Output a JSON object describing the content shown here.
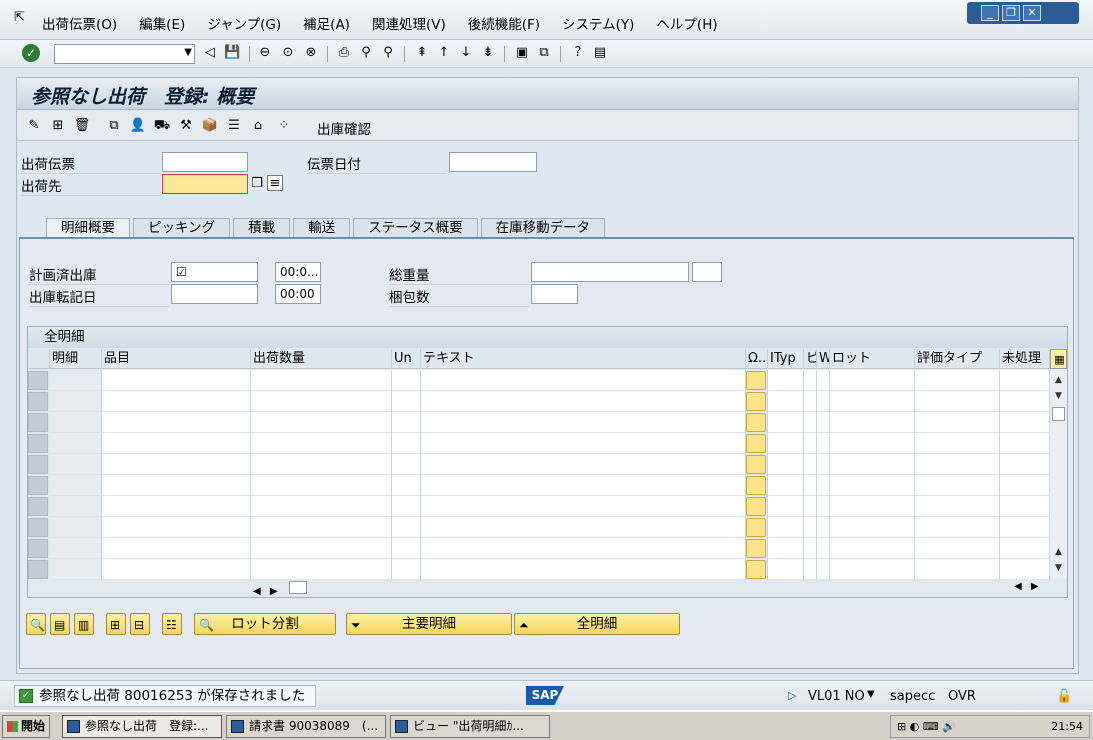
{
  "menubar": {
    "items": [
      "出荷伝票(O)",
      "編集(E)",
      "ジャンプ(G)",
      "補足(A)",
      "関連処理(V)",
      "後続機能(F)",
      "システム(Y)",
      "ヘルプ(H)"
    ]
  },
  "toolbar": {
    "command_value": ""
  },
  "title": "参照なし出荷　登録: 概要",
  "appbar": {
    "label": "出庫確認"
  },
  "header_fields": {
    "delivery_label": "出荷伝票",
    "delivery_value": "",
    "ship_to_label": "出荷先",
    "ship_to_value": "",
    "doc_date_label": "伝票日付",
    "doc_date_value": ""
  },
  "tabs": [
    "明細概要",
    "ピッキング",
    "積載",
    "輸送",
    "ステータス概要",
    "在庫移動データ"
  ],
  "tab_fields": {
    "planned_gi_label": "計画済出庫",
    "planned_gi_value": "☑",
    "planned_gi_time": "00:0...",
    "gi_posting_label": "出庫転記日",
    "gi_posting_value": "",
    "gi_posting_time": "00:00",
    "total_weight_label": "総重量",
    "total_weight_value": "",
    "total_weight_unit": "",
    "packages_label": "梱包数",
    "packages_value": ""
  },
  "table": {
    "title": "全明細",
    "columns": [
      "明細",
      "品目",
      "出荷数量",
      "Un",
      "テキスト",
      "Ω...",
      "ITyp",
      "ピ",
      "W",
      "ロット",
      "評価タイプ",
      "未処理"
    ],
    "rows": 10
  },
  "buttons": {
    "lot_split": "ロット分割",
    "main_items": "主要明細",
    "all_items": "全明細"
  },
  "status": {
    "message": "参照なし出荷 80016253 が保存されました",
    "logo": "SAP",
    "system": "VL01 NO",
    "server": "sapecc",
    "mode": "OVR"
  },
  "taskbar": {
    "start": "開始",
    "tasks": [
      "参照なし出荷　登録:...",
      "請求書 90038089　(...",
      "ビュー \"出荷明細ｶ..."
    ],
    "clock": "21:54"
  }
}
